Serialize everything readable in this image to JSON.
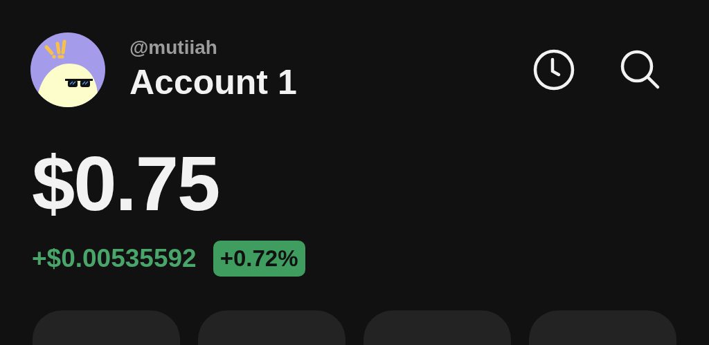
{
  "account": {
    "username": "@mutiiah",
    "name": "Account 1"
  },
  "balance": {
    "amount": "$0.75",
    "change": "+$0.00535592",
    "percent": "+0.72%",
    "positive": true
  }
}
